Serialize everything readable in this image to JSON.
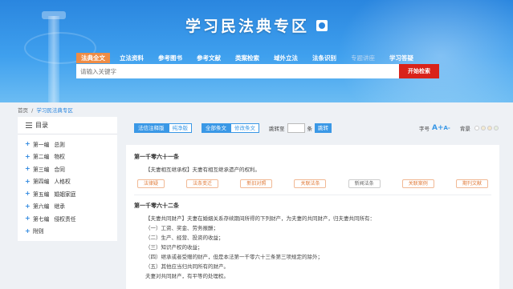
{
  "banner": {
    "title": "学习民法典专区"
  },
  "nav": {
    "items": [
      {
        "label": "法典全文",
        "active": true
      },
      {
        "label": "立法资料"
      },
      {
        "label": "参考图书"
      },
      {
        "label": "参考文献"
      },
      {
        "label": "类案检索"
      },
      {
        "label": "域外立法"
      },
      {
        "label": "法条识别"
      },
      {
        "label": "专题讲座",
        "dim": true
      },
      {
        "label": "学习答疑"
      }
    ]
  },
  "search": {
    "placeholder": "请输入关键字",
    "button": "开始检索"
  },
  "breadcrumb": {
    "home": "首页",
    "sep": "/",
    "current": "学习民法典专区"
  },
  "sidebar": {
    "title": "目录",
    "items": [
      {
        "part": "第一编",
        "name": "总则"
      },
      {
        "part": "第二编",
        "name": "物权"
      },
      {
        "part": "第三编",
        "name": "合同"
      },
      {
        "part": "第四编",
        "name": "人格权"
      },
      {
        "part": "第五编",
        "name": "婚姻家庭"
      },
      {
        "part": "第六编",
        "name": "继承"
      },
      {
        "part": "第七编",
        "name": "侵权责任"
      },
      {
        "part": "附则",
        "name": ""
      }
    ]
  },
  "toolbar": {
    "annot_on": "法信注释版",
    "annot_off": "纯净版",
    "all_on": "全部条文",
    "all_off": "修改条文",
    "jump_label": "跳转至",
    "jump_unit": "条",
    "jump_btn": "跳转",
    "font_label": "字号",
    "font_big": "A+",
    "font_small": "A-",
    "bg_label": "背景",
    "swatches": [
      "#ffffff",
      "#f3ead2",
      "#f7e6c8",
      "#e6efe0"
    ]
  },
  "articles": [
    {
      "title": "第一千零六十一条",
      "lines": [
        "【夫妻相互继承权】夫妻有相互继承遗产的权利。"
      ],
      "tags": [
        "法律疑",
        "法条变迁",
        "新旧对照",
        "关联法条",
        "新闻法条",
        "关联案例",
        "期刊文献"
      ]
    },
    {
      "title": "第一千零六十二条",
      "lines": [
        "【夫妻共同财产】夫妻在婚姻关系存续期间所得的下列财产，为夫妻的共同财产，归夫妻共同所有：",
        "（一）工资、奖金、劳务报酬；",
        "（二）生产、经营、投资的收益；",
        "（三）知识产权的收益；",
        "（四）继承或者受赠的财产，但是本法第一千零六十三条第三项规定的除外；",
        "（五）其他应当归共同所有的财产。",
        "夫妻对共同财产，有平等的处理权。"
      ]
    }
  ]
}
